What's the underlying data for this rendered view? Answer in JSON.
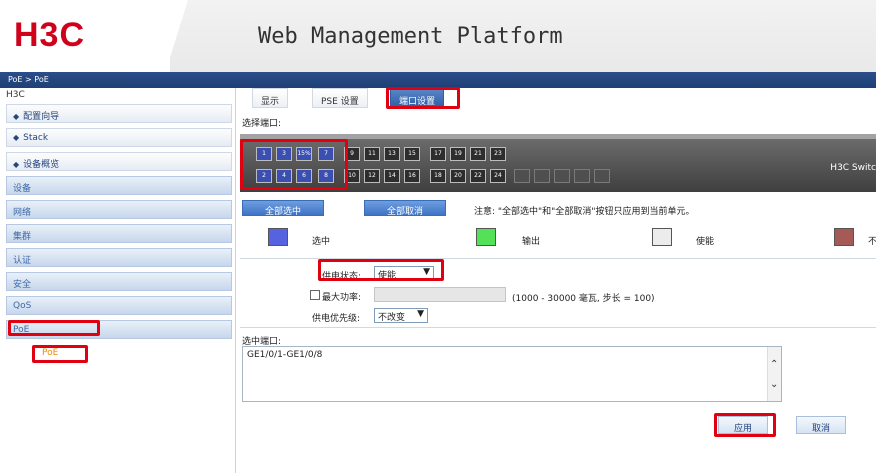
{
  "header": {
    "logo_text": "H3C",
    "platform_title": "Web Management Platform"
  },
  "breadcrumb": "PoE > PoE",
  "sidebar": {
    "device_name": "H3C",
    "top_items": [
      "配置向导",
      "Stack",
      "设备概览"
    ],
    "sub_items": [
      "设备",
      "网络",
      "集群",
      "认证",
      "安全",
      "QoS",
      "PoE"
    ],
    "active_child": "PoE"
  },
  "tabs": [
    {
      "label": "显示",
      "active": false
    },
    {
      "label": "PSE 设置",
      "active": false
    },
    {
      "label": "端口设置",
      "active": true
    }
  ],
  "select_port_label": "选择端口:",
  "switch": {
    "model_text": "H3C Switc",
    "top_ports": [
      "1",
      "3",
      "15%",
      "7",
      "9",
      "11",
      "13",
      "15",
      "17",
      "19",
      "21",
      "23"
    ],
    "bottom_ports": [
      "2",
      "4",
      "6",
      "8",
      "10",
      "12",
      "14",
      "16",
      "18",
      "20",
      "22",
      "24"
    ],
    "selected_ports": [
      "1",
      "2",
      "3",
      "4",
      "15%",
      "6",
      "7",
      "8"
    ]
  },
  "buttons": {
    "select_all": "全部选中",
    "deselect_all": "全部取消",
    "apply": "应用",
    "cancel": "取消"
  },
  "note": "注意: \"全部选中\"和\"全部取消\"按钮只应用到当前单元。",
  "legend": [
    {
      "label": "选中",
      "color": "#5563e0"
    },
    {
      "label": "输出",
      "color": "#55e05a"
    },
    {
      "label": "使能",
      "color": "#ececec"
    },
    {
      "label": "不",
      "color": "#a65a55"
    }
  ],
  "settings": {
    "power_state_label": "供电状态:",
    "power_state_value": "使能",
    "max_power_label": "最大功率:",
    "max_power_hint": "(1000 - 30000 毫瓦, 步长 = 100)",
    "priority_label": "供电优先级:",
    "priority_value": "不改变"
  },
  "selected_ports_label": "选中端口:",
  "selected_ports_value": "GE1/0/1-GE1/0/8"
}
